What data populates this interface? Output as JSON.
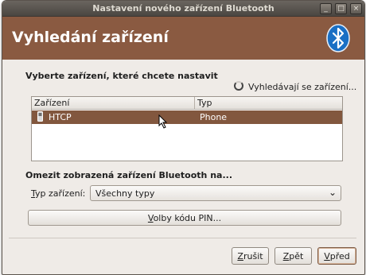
{
  "window": {
    "title": "Nastavení nového zařízení Bluetooth",
    "controls": {
      "minimize": "_",
      "maximize": "□",
      "close": "×"
    }
  },
  "banner": {
    "title": "Vyhledání zařízení",
    "icon": "bluetooth-icon",
    "color": "#8a5a41"
  },
  "devices": {
    "heading": "Vyberte zařízení, které chcete nastavit",
    "scan_status": "Vyhledávají se zařízení...",
    "columns": [
      "Zařízení",
      "Typ"
    ],
    "rows": [
      {
        "name": "HTCP",
        "type": "Phone",
        "icon": "phone-icon",
        "selected": true
      }
    ]
  },
  "filter": {
    "heading": "Omezit zobrazená zařízení Bluetooth na...",
    "label_mnemonic": "T",
    "label_rest": "yp zařízení:",
    "selected": "Všechny typy"
  },
  "pin_button": {
    "mnemonic": "V",
    "rest": "olby kódu PIN..."
  },
  "buttons": {
    "cancel": {
      "mnemonic": "Z",
      "rest": "rušit"
    },
    "back": {
      "mnemonic": "Z",
      "rest": "pět"
    },
    "forward": {
      "mnemonic": "V",
      "rest": "před"
    }
  },
  "colors": {
    "accent": "#82573e",
    "window_bg": "#efebe7"
  }
}
